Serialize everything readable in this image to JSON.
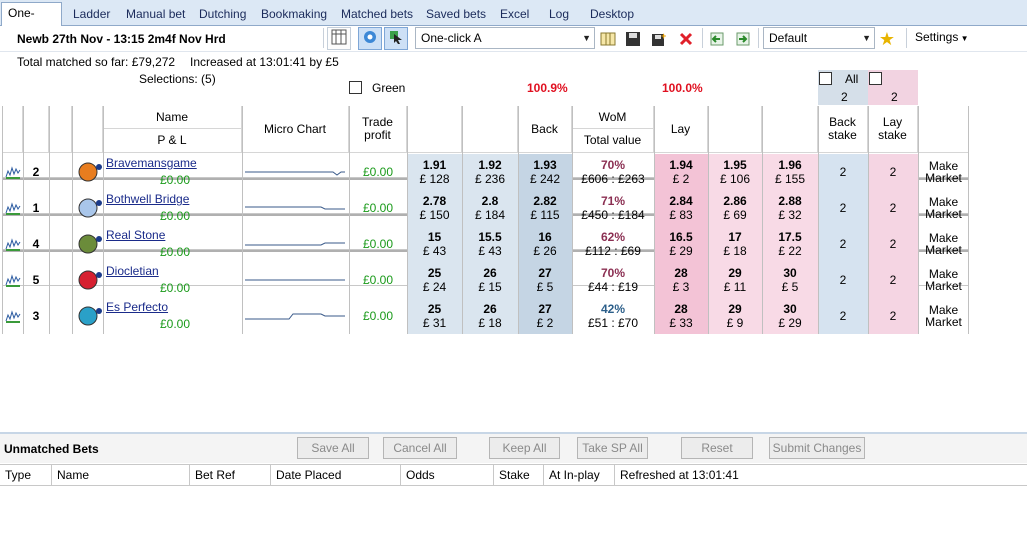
{
  "tabs": [
    "One-click",
    "Ladder",
    "Manual bet",
    "Dutching",
    "Bookmaking",
    "Matched bets",
    "Saved bets",
    "Excel",
    "Log",
    "Desktop"
  ],
  "race_title": "Newb 27th Nov - 13:15 2m4f Nov Hrd",
  "toolbar": {
    "profile_select": "One-click A",
    "preset_select": "Default",
    "settings_label": "Settings",
    "icons": [
      "grid-icon",
      "gear-icon",
      "cursor-icon",
      "columns-icon",
      "save-icon",
      "save-new-icon",
      "delete-icon",
      "import-icon",
      "export-icon",
      "star-icon"
    ]
  },
  "info": {
    "total_matched": "Total matched so far: £79,272",
    "increased": "Increased at 13:01:41 by £5",
    "selections": "Selections: (5)",
    "green_label": "Green",
    "back_book": "100.9%",
    "lay_book": "100.0%",
    "all_label": "All",
    "all_back_value": "2",
    "all_lay_value": "2"
  },
  "headers": {
    "name": "Name",
    "pl": "P & L",
    "micro_chart": "Micro Chart",
    "trade_profit": "Trade profit",
    "back": "Back",
    "wom": "WoM",
    "total_value": "Total value",
    "lay": "Lay",
    "back_stake": "Back stake",
    "lay_stake": "Lay stake"
  },
  "runners": [
    {
      "num": "2",
      "name": "Bravemansgame",
      "pl": "£0.00",
      "trade": "£0.00",
      "b3": "1.91",
      "b3a": "£ 128",
      "b2": "1.92",
      "b2a": "£ 236",
      "b1": "1.93",
      "b1a": "£ 242",
      "wom": "70%",
      "wom_color": "#8b2f52",
      "tv": "£606 : £263",
      "l1": "1.94",
      "l1a": "£ 2",
      "l2": "1.95",
      "l2a": "£ 106",
      "l3": "1.96",
      "l3a": "£ 155",
      "bs": "2",
      "ls": "2",
      "mm": "Make Market",
      "silk": "#e87d1f",
      "chart": [
        0.5,
        0.5,
        0.5,
        0.5,
        0.5,
        0.5,
        0.5,
        0.5,
        0.5,
        0.5,
        0.5,
        0.5,
        0.5,
        0.5,
        0.5,
        0.5,
        0.5,
        0.5,
        0.5,
        0.5,
        0.5,
        0.5,
        0.5,
        0.35,
        0.5,
        0.5
      ]
    },
    {
      "num": "1",
      "name": "Bothwell Bridge",
      "pl": "£0.00",
      "trade": "£0.00",
      "b3": "2.78",
      "b3a": "£ 150",
      "b2": "2.8",
      "b2a": "£ 184",
      "b1": "2.82",
      "b1a": "£ 115",
      "wom": "71%",
      "wom_color": "#8b2f52",
      "tv": "£450 : £184",
      "l1": "2.84",
      "l1a": "£ 83",
      "l2": "2.86",
      "l2a": "£ 69",
      "l3": "2.88",
      "l3a": "£ 32",
      "bs": "2",
      "ls": "2",
      "mm": "Make Market",
      "silk": "#a9c6ea",
      "chart": [
        0.55,
        0.55,
        0.55,
        0.55,
        0.55,
        0.55,
        0.55,
        0.55,
        0.55,
        0.55,
        0.55,
        0.55,
        0.55,
        0.55,
        0.55,
        0.55,
        0.55,
        0.55,
        0.55,
        0.55,
        0.45,
        0.45,
        0.45,
        0.45,
        0.45,
        0.45
      ]
    },
    {
      "num": "4",
      "name": "Real Stone",
      "pl": "£0.00",
      "trade": "£0.00",
      "b3": "15",
      "b3a": "£ 43",
      "b2": "15.5",
      "b2a": "£ 43",
      "b1": "16",
      "b1a": "£ 26",
      "wom": "62%",
      "wom_color": "#8b2f52",
      "tv": "£112 : £69",
      "l1": "16.5",
      "l1a": "£ 29",
      "l2": "17",
      "l2a": "£ 18",
      "l3": "17.5",
      "l3a": "£ 22",
      "bs": "2",
      "ls": "2",
      "mm": "Make Market",
      "silk": "#6b8c3a",
      "chart": [
        0.45,
        0.45,
        0.45,
        0.45,
        0.45,
        0.45,
        0.45,
        0.45,
        0.45,
        0.45,
        0.45,
        0.45,
        0.45,
        0.45,
        0.45,
        0.45,
        0.45,
        0.45,
        0.45,
        0.45,
        0.55,
        0.55,
        0.55,
        0.55,
        0.55,
        0.55
      ]
    },
    {
      "num": "5",
      "name": "Diocletian",
      "pl": "£0.00",
      "trade": "£0.00",
      "b3": "25",
      "b3a": "£ 24",
      "b2": "26",
      "b2a": "£ 15",
      "b1": "27",
      "b1a": "£ 5",
      "wom": "70%",
      "wom_color": "#8b2f52",
      "tv": "£44 : £19",
      "l1": "28",
      "l1a": "£ 3",
      "l2": "29",
      "l2a": "£ 11",
      "l3": "30",
      "l3a": "£ 5",
      "bs": "2",
      "ls": "2",
      "mm": "Make Market",
      "silk": "#d62030",
      "chart": [
        0.5,
        0.5,
        0.5,
        0.5,
        0.5,
        0.5,
        0.5,
        0.5,
        0.5,
        0.5,
        0.5,
        0.5,
        0.5,
        0.5,
        0.5,
        0.5,
        0.5,
        0.5,
        0.5,
        0.5,
        0.5,
        0.5,
        0.5,
        0.5,
        0.5,
        0.5
      ]
    },
    {
      "num": "3",
      "name": "Es Perfecto",
      "pl": "£0.00",
      "trade": "£0.00",
      "b3": "25",
      "b3a": "£ 31",
      "b2": "26",
      "b2a": "£ 18",
      "b1": "27",
      "b1a": "£ 2",
      "wom": "42%",
      "wom_color": "#2c5f8a",
      "tv": "£51 : £70",
      "l1": "28",
      "l1a": "£ 33",
      "l2": "29",
      "l2a": "£ 9",
      "l3": "30",
      "l3a": "£ 29",
      "bs": "2",
      "ls": "2",
      "mm": "Make Market",
      "silk": "#2aa0c8",
      "chart": [
        0.35,
        0.35,
        0.35,
        0.35,
        0.35,
        0.35,
        0.35,
        0.35,
        0.35,
        0.35,
        0.35,
        0.35,
        0.6,
        0.6,
        0.6,
        0.6,
        0.6,
        0.6,
        0.6,
        0.6,
        0.5,
        0.5,
        0.5,
        0.5,
        0.5,
        0.5
      ]
    }
  ],
  "unmatched": {
    "title": "Unmatched Bets",
    "buttons": [
      "Save All",
      "Cancel All",
      "Keep All",
      "Take SP All",
      "Reset",
      "Submit Changes"
    ],
    "columns": [
      "Type",
      "Name",
      "Bet Ref",
      "Date Placed",
      "Odds",
      "Stake",
      "At In-play",
      "Refreshed at 13:01:41"
    ]
  }
}
